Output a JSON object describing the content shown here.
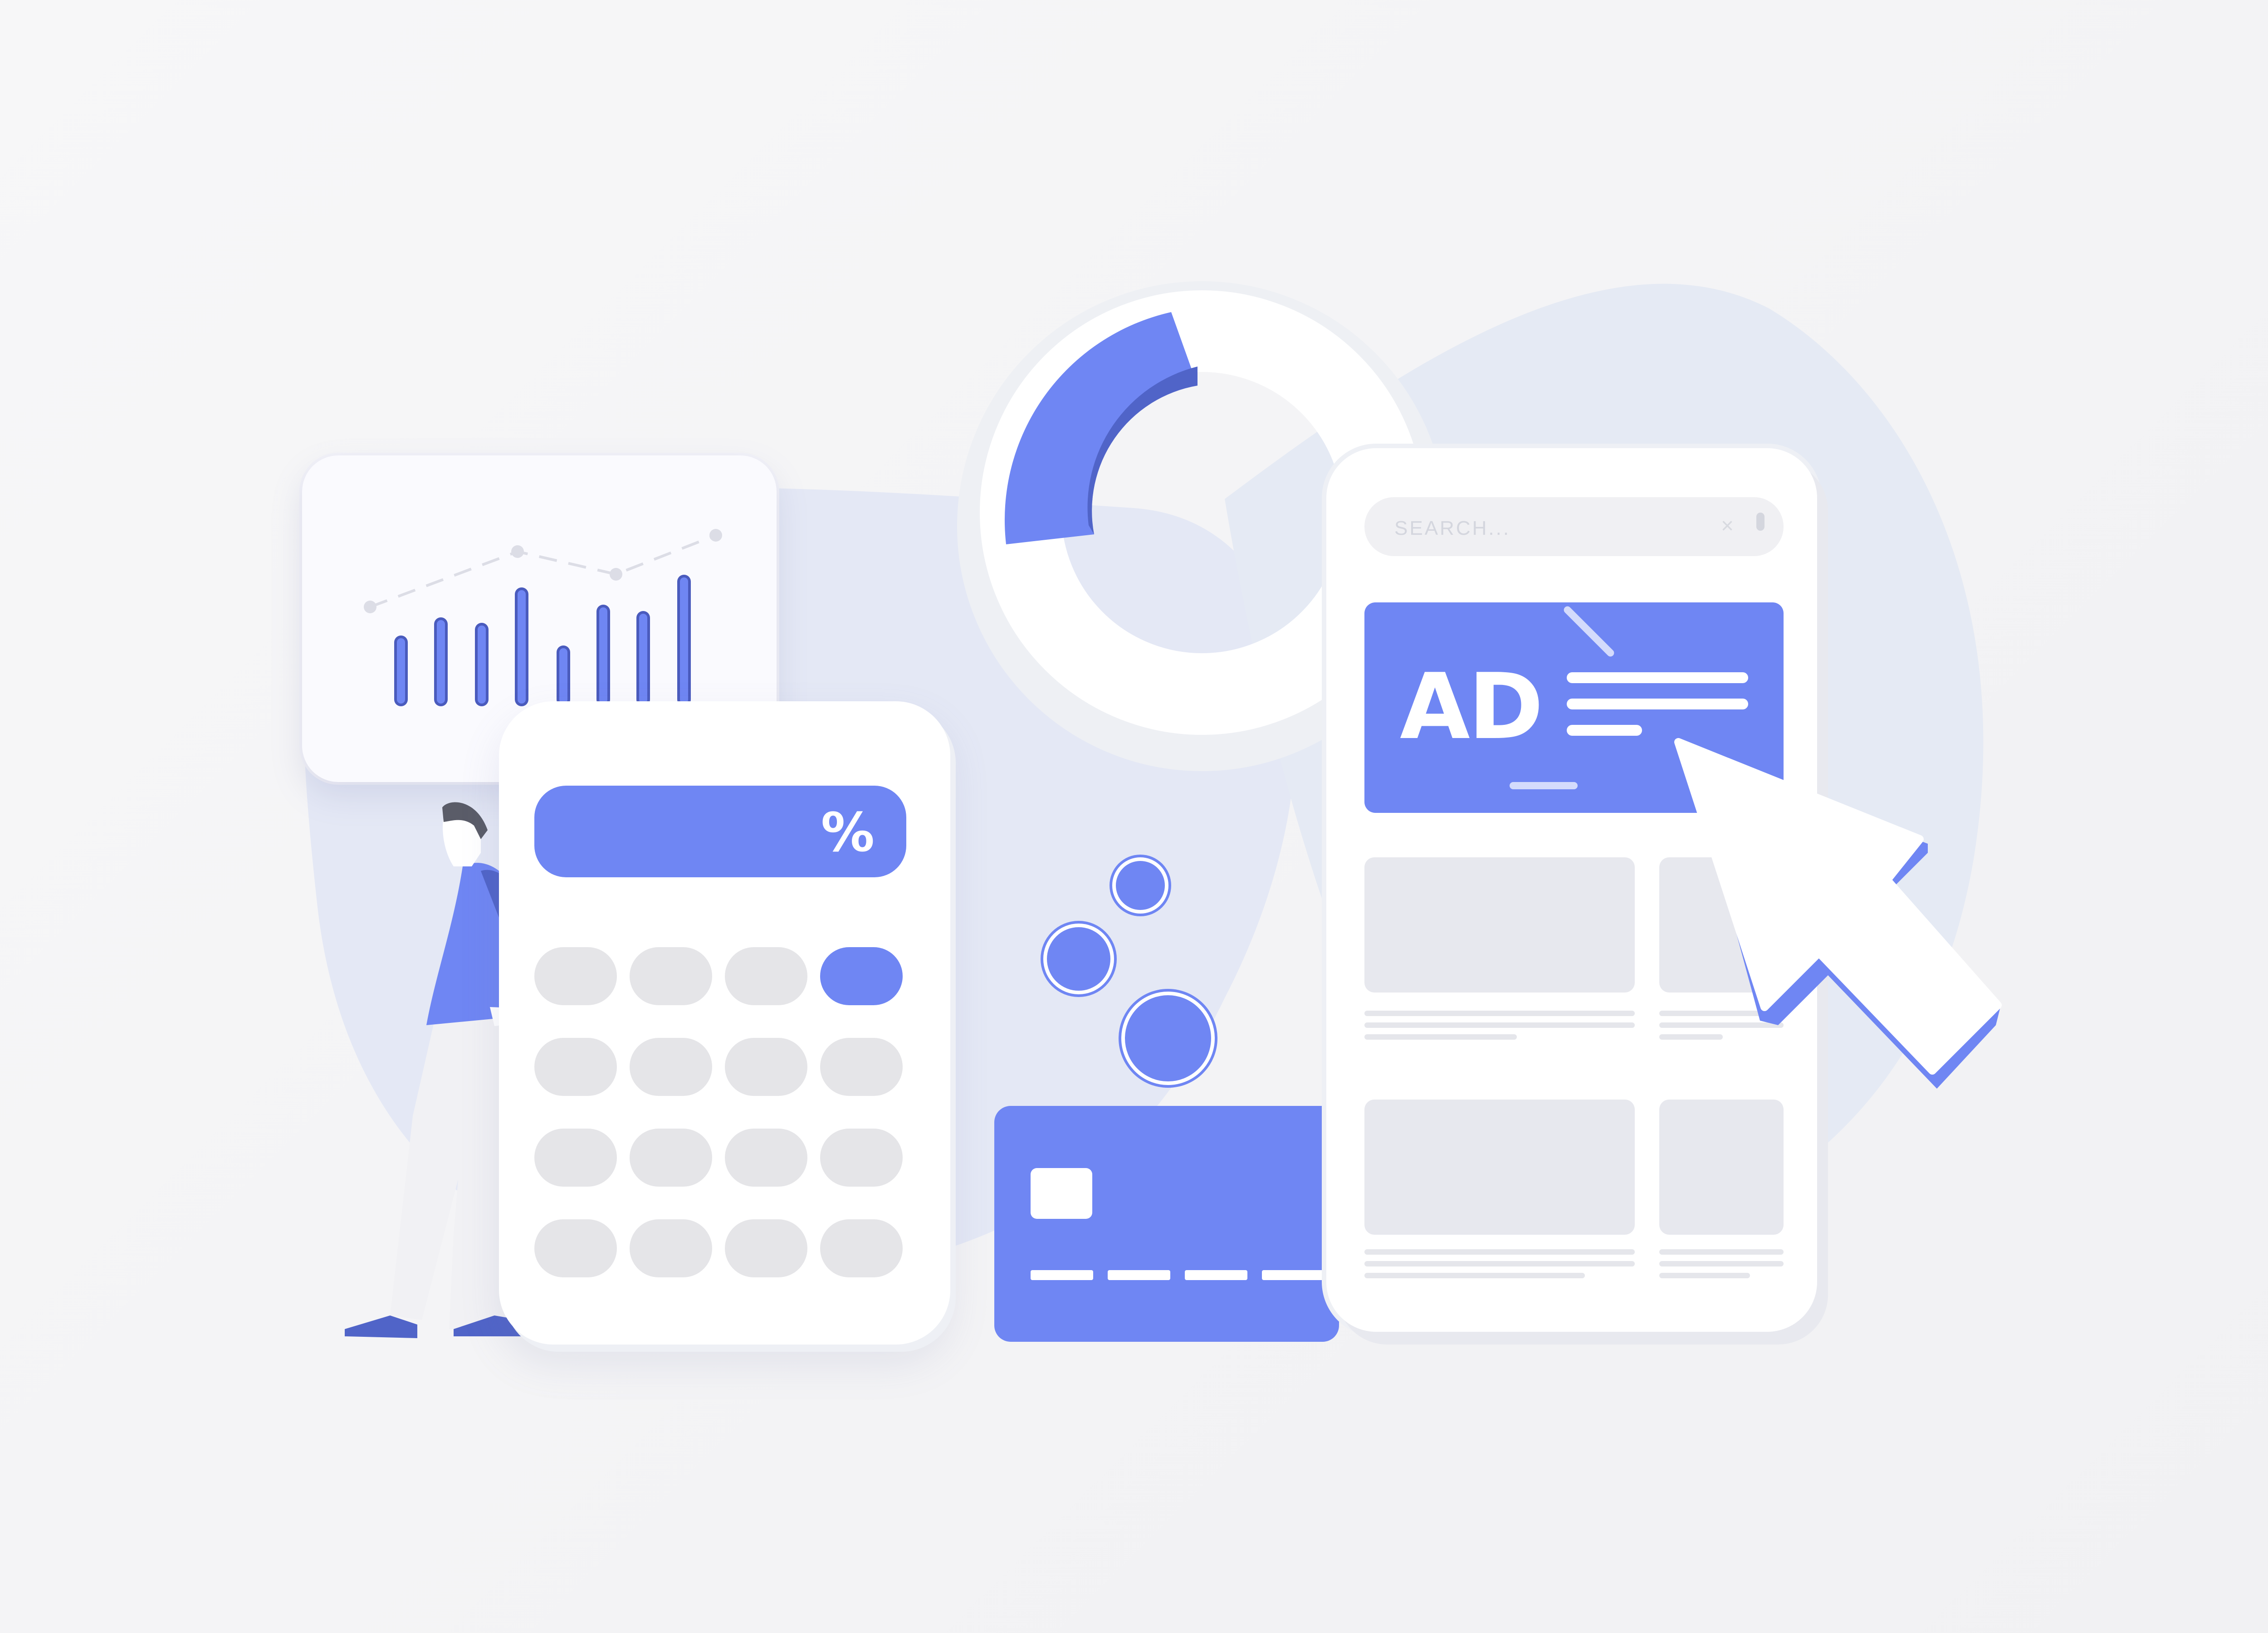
{
  "colors": {
    "accent": "#6f86f3",
    "accent_dark": "#5064c8",
    "blob": "#e4e8f5",
    "tile": "#e7e8ee",
    "key": "#e5e5e8",
    "background": "#f4f4f6"
  },
  "calculator": {
    "display_symbol": "%",
    "accent_key_index": 3
  },
  "phone": {
    "search_placeholder": "SEARCH...",
    "clear_icon": "×",
    "ad_label": "AD"
  },
  "icons": {
    "cursor": "arrow-cursor-icon",
    "donut": "donut-chart-icon",
    "bar_chart": "bar-chart-icon",
    "credit_card": "credit-card-icon",
    "coins": "coin-icon",
    "person": "person-illustration"
  }
}
